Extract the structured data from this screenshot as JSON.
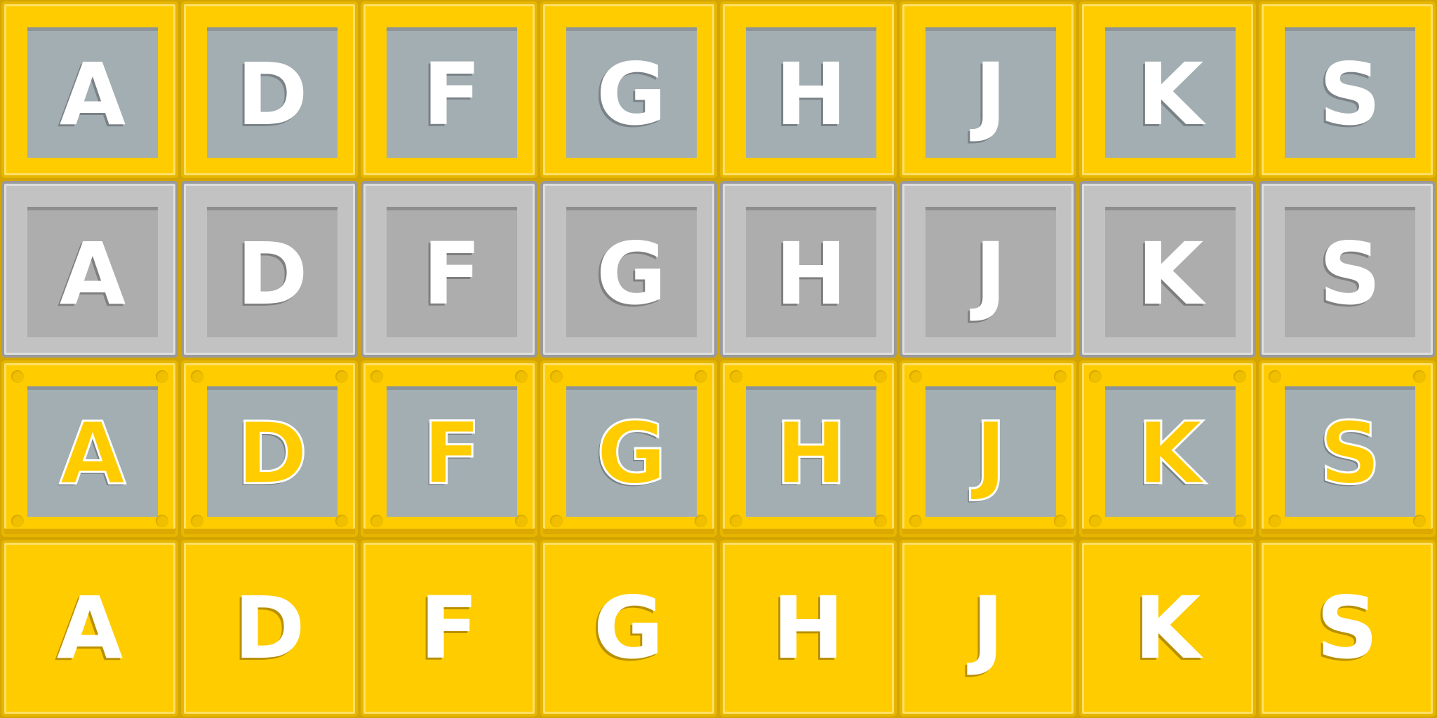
{
  "rows": [
    {
      "style": "yellow-frame-slate-face",
      "keys": [
        "A",
        "D",
        "F",
        "G",
        "H",
        "J",
        "K",
        "S"
      ]
    },
    {
      "style": "gray-frame-gray-face",
      "keys": [
        "A",
        "D",
        "F",
        "G",
        "H",
        "J",
        "K",
        "S"
      ]
    },
    {
      "style": "yellow-frame-riveted-outlined-letter",
      "keys": [
        "A",
        "D",
        "F",
        "G",
        "H",
        "J",
        "K",
        "S"
      ]
    },
    {
      "style": "flat-yellow",
      "keys": [
        "A",
        "D",
        "F",
        "G",
        "H",
        "J",
        "K",
        "S"
      ]
    }
  ],
  "colors": {
    "yellow": "#ffcc00",
    "slate": "#a3aeb3",
    "gray": "#c2c2c2",
    "letter": "#ffffff"
  }
}
